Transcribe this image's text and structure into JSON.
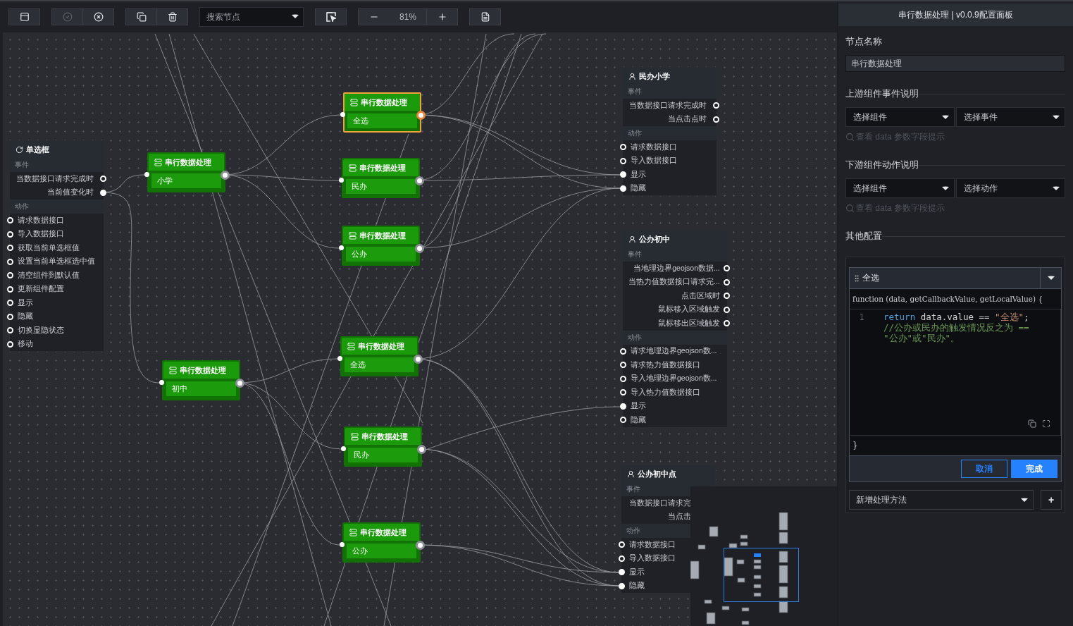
{
  "toolbar": {
    "items": [
      {
        "kind": "group",
        "buttons": [
          {
            "kind": "panel",
            "disabled": false
          }
        ]
      },
      {
        "kind": "group",
        "buttons": [
          {
            "kind": "check",
            "disabled": true
          },
          {
            "kind": "close",
            "disabled": false
          }
        ]
      },
      {
        "kind": "group",
        "buttons": [
          {
            "kind": "copy",
            "disabled": false
          },
          {
            "kind": "delete",
            "disabled": false
          }
        ]
      },
      {
        "kind": "search",
        "placeholder": "搜索节点"
      },
      {
        "kind": "group",
        "buttons": [
          {
            "kind": "select",
            "disabled": false
          }
        ]
      },
      {
        "kind": "zoom",
        "value": "81%"
      },
      {
        "kind": "group",
        "buttons": [
          {
            "kind": "document",
            "disabled": false
          }
        ]
      }
    ]
  },
  "canvas": {
    "components": [
      {
        "kind": "radio",
        "title": "单选框",
        "events_label": "事件",
        "events": [
          {
            "label": "当数据接口请求完成时",
            "connected": false
          },
          {
            "label": "当前值变化时",
            "connected": true
          }
        ],
        "actions_label": "动作",
        "actions": [
          {
            "label": "请求数据接口",
            "connected": false
          },
          {
            "label": "导入数据接口",
            "connected": false
          },
          {
            "label": "获取当前单选框值",
            "connected": false
          },
          {
            "label": "设置当前单选框选中值",
            "connected": false
          },
          {
            "label": "清空组件到默认值",
            "connected": false
          },
          {
            "label": "更新组件配置",
            "connected": false
          },
          {
            "label": "显示",
            "connected": false
          },
          {
            "label": "隐藏",
            "connected": false
          },
          {
            "label": "切换显隐状态",
            "connected": false
          },
          {
            "label": "移动",
            "connected": false
          }
        ]
      },
      {
        "kind": "map",
        "title": "民办小学",
        "events_label": "事件",
        "events": [
          {
            "label": "当数据接口请求完成时",
            "connected": false
          },
          {
            "label": "当点击点时",
            "connected": false
          }
        ],
        "actions_label": "动作",
        "actions": [
          {
            "label": "请求数据接口",
            "connected": false
          },
          {
            "label": "导入数据接口",
            "connected": false
          },
          {
            "label": "显示",
            "connected": true
          },
          {
            "label": "隐藏",
            "connected": true
          }
        ]
      },
      {
        "kind": "map",
        "title": "公办初中",
        "events_label": "事件",
        "events": [
          {
            "label": "当地理边界geojson数据...",
            "connected": false
          },
          {
            "label": "当热力值数据接口请求完...",
            "connected": false
          },
          {
            "label": "点击区域时",
            "connected": false
          },
          {
            "label": "鼠标移入区域触发",
            "connected": false
          },
          {
            "label": "鼠标移出区域触发",
            "connected": false
          }
        ],
        "actions_label": "动作",
        "actions": [
          {
            "label": "请求地理边界geojson数...",
            "connected": false
          },
          {
            "label": "请求热力值数据接口",
            "connected": false
          },
          {
            "label": "导入地理边界geojson数...",
            "connected": false
          },
          {
            "label": "导入热力值数据接口",
            "connected": false
          },
          {
            "label": "显示",
            "connected": true
          },
          {
            "label": "隐藏",
            "connected": false
          }
        ]
      },
      {
        "kind": "map",
        "title": "公办初中点",
        "events_label": "事件",
        "events": [
          {
            "label": "当数据接口请求完"
          },
          {
            "label": "当点击"
          }
        ],
        "actions_label": "动作",
        "actions": [
          {
            "label": "请求数据接口",
            "connected": false
          },
          {
            "label": "导入数据接口",
            "connected": false
          },
          {
            "label": "显示",
            "connected": true
          },
          {
            "label": "隐藏",
            "connected": true
          }
        ]
      }
    ],
    "processors": [
      {
        "title": "串行数据处理",
        "label": "小学",
        "selected": false
      },
      {
        "title": "串行数据处理",
        "label": "全选",
        "selected": true
      },
      {
        "title": "串行数据处理",
        "label": "民办",
        "selected": false
      },
      {
        "title": "串行数据处理",
        "label": "公办",
        "selected": false
      },
      {
        "title": "串行数据处理",
        "label": "全选",
        "selected": false
      },
      {
        "title": "串行数据处理",
        "label": "初中",
        "selected": false
      },
      {
        "title": "串行数据处理",
        "label": "民办",
        "selected": false
      },
      {
        "title": "串行数据处理",
        "label": "公办",
        "selected": false
      }
    ]
  },
  "panel": {
    "title": "串行数据处理 | v0.0.9配置面板",
    "name_label": "节点名称",
    "name_value": "串行数据处理",
    "sections": [
      {
        "heading": "上游组件事件说明",
        "selects": [
          "选择组件",
          "选择事件"
        ],
        "hint": "查看 data 参数字段提示"
      },
      {
        "heading": "下游组件动作说明",
        "selects": [
          "选择组件",
          "选择动作"
        ],
        "hint": "查看 data 参数字段提示"
      }
    ],
    "other_heading": "其他配置",
    "method": {
      "name": "全选",
      "signature": "function (data, getCallbackValue, getLocalValue) {",
      "lines": [
        {
          "number": "1",
          "tokens": [
            {
              "kind": "keyword",
              "text": "return"
            },
            {
              "kind": "plain",
              "text": " data.value == "
            },
            {
              "kind": "string",
              "text": "\"全选\""
            },
            {
              "kind": "plain",
              "text": "; "
            },
            {
              "kind": "comment",
              "text": "//公办或民办的触发情况反之为 == \"公办\"或\"民办\"。"
            }
          ]
        }
      ],
      "closing": "}",
      "cancel": "取消",
      "confirm": "完成"
    },
    "new_method": {
      "placeholder": "新增处理方法"
    },
    "add_button": "+"
  }
}
